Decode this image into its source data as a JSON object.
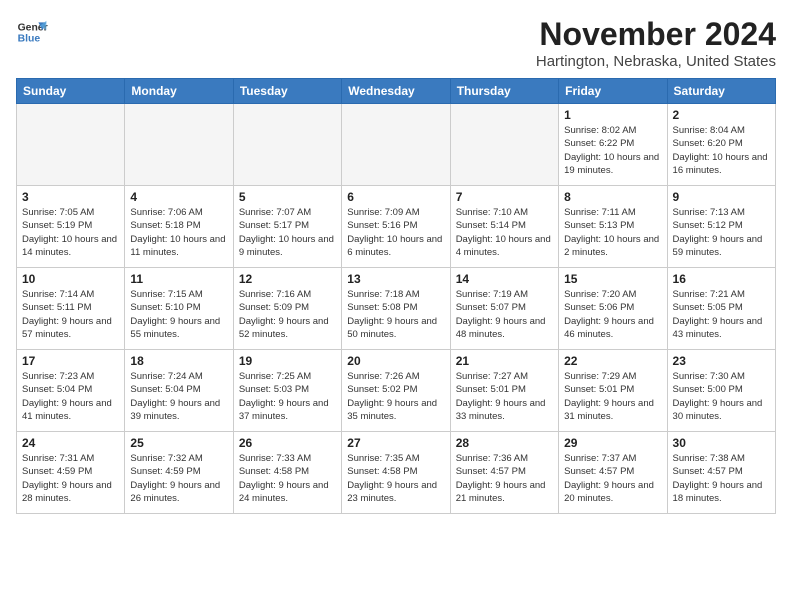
{
  "header": {
    "logo_line1": "General",
    "logo_line2": "Blue",
    "month_title": "November 2024",
    "location": "Hartington, Nebraska, United States"
  },
  "days_of_week": [
    "Sunday",
    "Monday",
    "Tuesday",
    "Wednesday",
    "Thursday",
    "Friday",
    "Saturday"
  ],
  "weeks": [
    [
      {
        "day": "",
        "info": ""
      },
      {
        "day": "",
        "info": ""
      },
      {
        "day": "",
        "info": ""
      },
      {
        "day": "",
        "info": ""
      },
      {
        "day": "",
        "info": ""
      },
      {
        "day": "1",
        "info": "Sunrise: 8:02 AM\nSunset: 6:22 PM\nDaylight: 10 hours and 19 minutes."
      },
      {
        "day": "2",
        "info": "Sunrise: 8:04 AM\nSunset: 6:20 PM\nDaylight: 10 hours and 16 minutes."
      }
    ],
    [
      {
        "day": "3",
        "info": "Sunrise: 7:05 AM\nSunset: 5:19 PM\nDaylight: 10 hours and 14 minutes."
      },
      {
        "day": "4",
        "info": "Sunrise: 7:06 AM\nSunset: 5:18 PM\nDaylight: 10 hours and 11 minutes."
      },
      {
        "day": "5",
        "info": "Sunrise: 7:07 AM\nSunset: 5:17 PM\nDaylight: 10 hours and 9 minutes."
      },
      {
        "day": "6",
        "info": "Sunrise: 7:09 AM\nSunset: 5:16 PM\nDaylight: 10 hours and 6 minutes."
      },
      {
        "day": "7",
        "info": "Sunrise: 7:10 AM\nSunset: 5:14 PM\nDaylight: 10 hours and 4 minutes."
      },
      {
        "day": "8",
        "info": "Sunrise: 7:11 AM\nSunset: 5:13 PM\nDaylight: 10 hours and 2 minutes."
      },
      {
        "day": "9",
        "info": "Sunrise: 7:13 AM\nSunset: 5:12 PM\nDaylight: 9 hours and 59 minutes."
      }
    ],
    [
      {
        "day": "10",
        "info": "Sunrise: 7:14 AM\nSunset: 5:11 PM\nDaylight: 9 hours and 57 minutes."
      },
      {
        "day": "11",
        "info": "Sunrise: 7:15 AM\nSunset: 5:10 PM\nDaylight: 9 hours and 55 minutes."
      },
      {
        "day": "12",
        "info": "Sunrise: 7:16 AM\nSunset: 5:09 PM\nDaylight: 9 hours and 52 minutes."
      },
      {
        "day": "13",
        "info": "Sunrise: 7:18 AM\nSunset: 5:08 PM\nDaylight: 9 hours and 50 minutes."
      },
      {
        "day": "14",
        "info": "Sunrise: 7:19 AM\nSunset: 5:07 PM\nDaylight: 9 hours and 48 minutes."
      },
      {
        "day": "15",
        "info": "Sunrise: 7:20 AM\nSunset: 5:06 PM\nDaylight: 9 hours and 46 minutes."
      },
      {
        "day": "16",
        "info": "Sunrise: 7:21 AM\nSunset: 5:05 PM\nDaylight: 9 hours and 43 minutes."
      }
    ],
    [
      {
        "day": "17",
        "info": "Sunrise: 7:23 AM\nSunset: 5:04 PM\nDaylight: 9 hours and 41 minutes."
      },
      {
        "day": "18",
        "info": "Sunrise: 7:24 AM\nSunset: 5:04 PM\nDaylight: 9 hours and 39 minutes."
      },
      {
        "day": "19",
        "info": "Sunrise: 7:25 AM\nSunset: 5:03 PM\nDaylight: 9 hours and 37 minutes."
      },
      {
        "day": "20",
        "info": "Sunrise: 7:26 AM\nSunset: 5:02 PM\nDaylight: 9 hours and 35 minutes."
      },
      {
        "day": "21",
        "info": "Sunrise: 7:27 AM\nSunset: 5:01 PM\nDaylight: 9 hours and 33 minutes."
      },
      {
        "day": "22",
        "info": "Sunrise: 7:29 AM\nSunset: 5:01 PM\nDaylight: 9 hours and 31 minutes."
      },
      {
        "day": "23",
        "info": "Sunrise: 7:30 AM\nSunset: 5:00 PM\nDaylight: 9 hours and 30 minutes."
      }
    ],
    [
      {
        "day": "24",
        "info": "Sunrise: 7:31 AM\nSunset: 4:59 PM\nDaylight: 9 hours and 28 minutes."
      },
      {
        "day": "25",
        "info": "Sunrise: 7:32 AM\nSunset: 4:59 PM\nDaylight: 9 hours and 26 minutes."
      },
      {
        "day": "26",
        "info": "Sunrise: 7:33 AM\nSunset: 4:58 PM\nDaylight: 9 hours and 24 minutes."
      },
      {
        "day": "27",
        "info": "Sunrise: 7:35 AM\nSunset: 4:58 PM\nDaylight: 9 hours and 23 minutes."
      },
      {
        "day": "28",
        "info": "Sunrise: 7:36 AM\nSunset: 4:57 PM\nDaylight: 9 hours and 21 minutes."
      },
      {
        "day": "29",
        "info": "Sunrise: 7:37 AM\nSunset: 4:57 PM\nDaylight: 9 hours and 20 minutes."
      },
      {
        "day": "30",
        "info": "Sunrise: 7:38 AM\nSunset: 4:57 PM\nDaylight: 9 hours and 18 minutes."
      }
    ]
  ]
}
